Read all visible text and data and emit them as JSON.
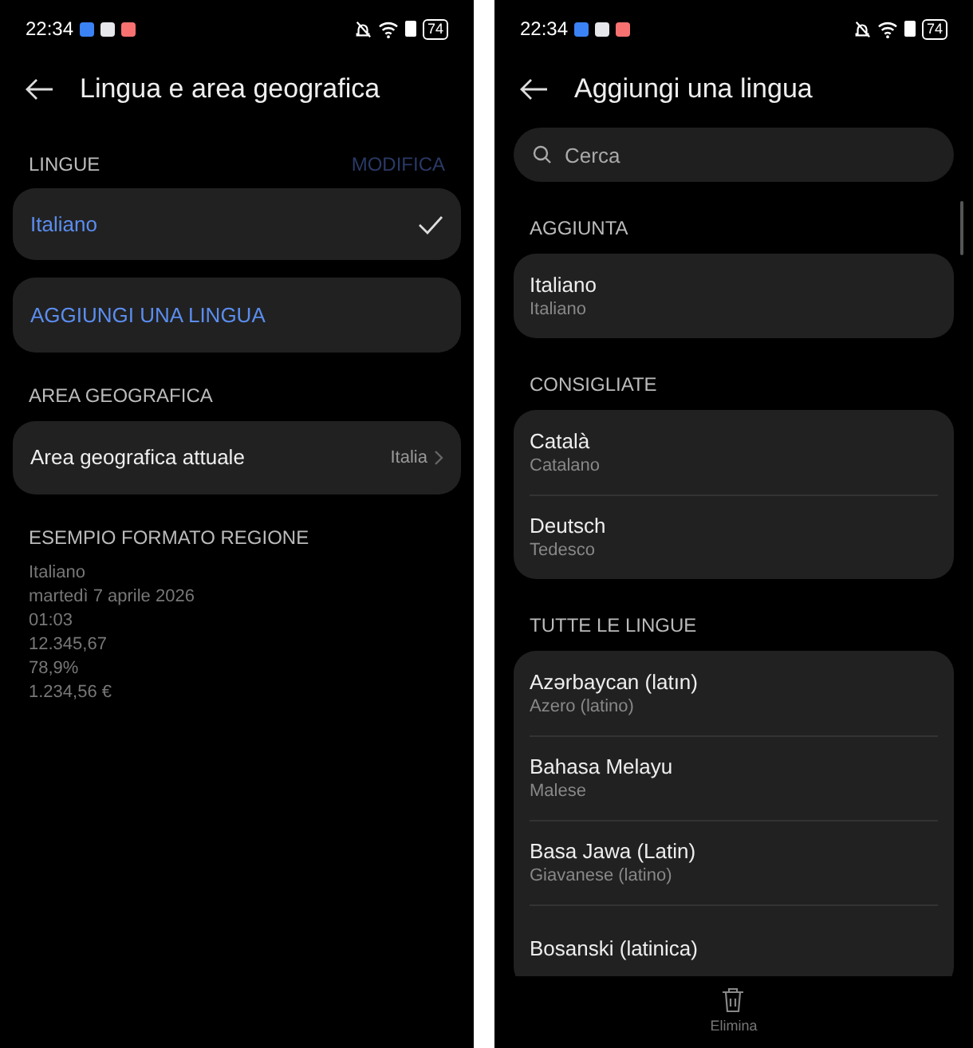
{
  "left_screen": {
    "status_bar": {
      "time": "22:34",
      "battery": "74"
    },
    "header": {
      "title": "Lingua e area geografica"
    },
    "languages_section": {
      "heading": "LINGUE",
      "edit_action": {
        "label": "MODIFICA",
        "disabled": true
      },
      "languages": [
        {
          "name": "Italiano",
          "selected": true
        }
      ],
      "add_button": "AGGIUNGI UNA LINGUA"
    },
    "region_section": {
      "heading": "AREA GEOGRAFICA",
      "row": {
        "label": "Area geografica attuale",
        "value": "Italia"
      }
    },
    "format_example": {
      "heading": "ESEMPIO FORMATO REGIONE",
      "lines": [
        "Italiano",
        "martedì 7 aprile 2026",
        "01:03",
        "12.345,67",
        "78,9%",
        "1.234,56 €"
      ]
    }
  },
  "right_screen": {
    "status_bar": {
      "time": "22:34",
      "battery": "74"
    },
    "header": {
      "title": "Aggiungi una lingua"
    },
    "search": {
      "placeholder": "Cerca"
    },
    "groups": [
      {
        "heading": "AGGIUNTA",
        "items": [
          {
            "name": "Italiano",
            "subtitle": "Italiano"
          }
        ]
      },
      {
        "heading": "CONSIGLIATE",
        "items": [
          {
            "name": "Català",
            "subtitle": "Catalano"
          },
          {
            "name": "Deutsch",
            "subtitle": "Tedesco"
          }
        ]
      },
      {
        "heading": "TUTTE LE LINGUE",
        "items": [
          {
            "name": "Azərbaycan (latın)",
            "subtitle": "Azero (latino)"
          },
          {
            "name": "Bahasa Melayu",
            "subtitle": "Malese"
          },
          {
            "name": "Basa Jawa (Latin)",
            "subtitle": "Giavanese (latino)"
          },
          {
            "name": "Bosanski (latinica)"
          }
        ]
      }
    ],
    "bottom_bar": {
      "action": "Elimina"
    }
  }
}
